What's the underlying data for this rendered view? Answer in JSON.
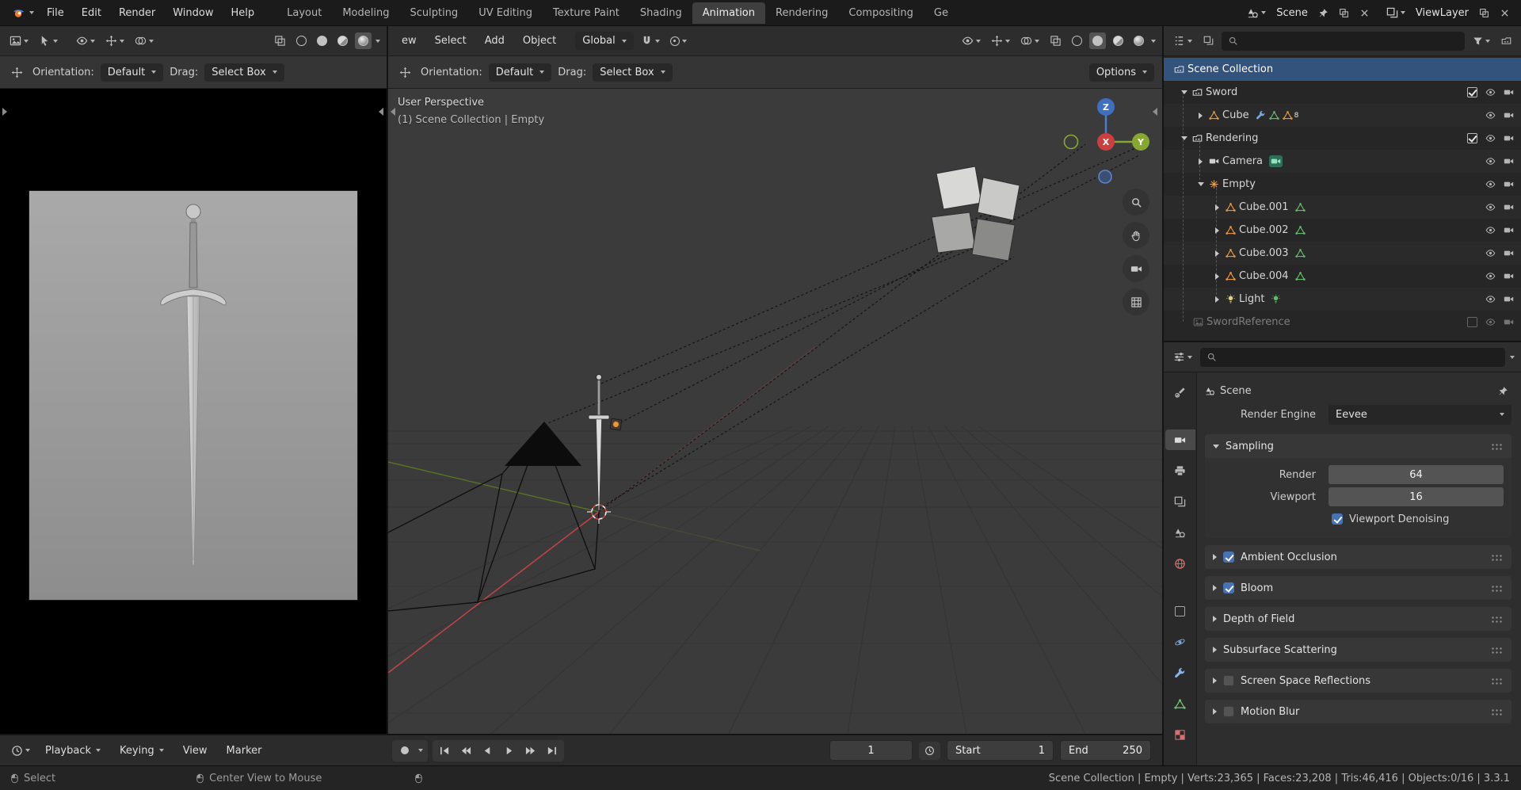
{
  "icons": {
    "logo": "blender-logo",
    "dropdown": "chevron-down",
    "search": "magnifier",
    "filter": "funnel",
    "pin": "pin",
    "duplicate": "copy",
    "close": "x",
    "eye": "eye",
    "camera_toggle": "movie-camera",
    "grip": "drag-dots"
  },
  "colors": {
    "accent": "#4772b3",
    "object_orange": "#e8973f",
    "data_green": "#66bb6a",
    "axis_x": "#cc3f3f",
    "axis_y": "#86a833",
    "axis_z": "#3f6fbf"
  },
  "topbar": {
    "menus": [
      "File",
      "Edit",
      "Render",
      "Window",
      "Help"
    ],
    "workspaces": [
      "Layout",
      "Modeling",
      "Sculpting",
      "UV Editing",
      "Texture Paint",
      "Shading",
      "Animation",
      "Rendering",
      "Compositing",
      "Ge"
    ],
    "active_workspace": "Animation",
    "scene_label": "Scene",
    "view_layer_label": "ViewLayer"
  },
  "left_editor": {
    "orientation_label": "Orientation:",
    "orientation_value": "Default",
    "drag_label": "Drag:",
    "drag_value": "Select Box"
  },
  "viewport": {
    "menus": [
      "ew",
      "Select",
      "Add",
      "Object"
    ],
    "transform_orientation": "Global",
    "orientation_label": "Orientation:",
    "orientation_value": "Default",
    "drag_label": "Drag:",
    "drag_value": "Select Box",
    "options_label": "Options",
    "overlay_title": "User Perspective",
    "overlay_subtitle": "(1) Scene Collection | Empty",
    "gizmo": {
      "x": "X",
      "y": "Y",
      "z": "Z"
    }
  },
  "outliner": {
    "rows": [
      {
        "label": "Scene Collection",
        "disclosure": "none",
        "checkbox": "none"
      },
      {
        "label": "Sword",
        "disclosure": "down",
        "checkbox": "on"
      },
      {
        "label": "Cube",
        "disclosure": "right",
        "checkbox": "none",
        "badge": "8"
      },
      {
        "label": "Rendering",
        "disclosure": "down",
        "checkbox": "on"
      },
      {
        "label": "Camera",
        "disclosure": "right",
        "checkbox": "none"
      },
      {
        "label": "Empty",
        "disclosure": "down",
        "checkbox": "none"
      },
      {
        "label": "Cube.001",
        "disclosure": "right",
        "checkbox": "none"
      },
      {
        "label": "Cube.002",
        "disclosure": "right",
        "checkbox": "none"
      },
      {
        "label": "Cube.003",
        "disclosure": "right",
        "checkbox": "none"
      },
      {
        "label": "Cube.004",
        "disclosure": "right",
        "checkbox": "none"
      },
      {
        "label": "Light",
        "disclosure": "right",
        "checkbox": "none"
      },
      {
        "label": "SwordReference",
        "disclosure": "none",
        "checkbox": "off"
      }
    ]
  },
  "properties": {
    "breadcrumb": "Scene",
    "render_engine_label": "Render Engine",
    "render_engine_value": "Eevee",
    "sampling": {
      "title": "Sampling",
      "render_label": "Render",
      "render_value": "64",
      "viewport_label": "Viewport",
      "viewport_value": "16",
      "denoise_label": "Viewport Denoising",
      "denoise_state": "on"
    },
    "sections": [
      {
        "label": "Ambient Occlusion",
        "checkbox": "on"
      },
      {
        "label": "Bloom",
        "checkbox": "on"
      },
      {
        "label": "Depth of Field",
        "checkbox": "none"
      },
      {
        "label": "Subsurface Scattering",
        "checkbox": "none"
      },
      {
        "label": "Screen Space Reflections",
        "checkbox": "off"
      },
      {
        "label": "Motion Blur",
        "checkbox": "off"
      }
    ]
  },
  "timeline": {
    "menus": [
      "Playback",
      "Keying",
      "View",
      "Marker"
    ],
    "current_frame": "1",
    "start_label": "Start",
    "start_value": "1",
    "end_label": "End",
    "end_value": "250"
  },
  "statusbar": {
    "left": "Select",
    "middle": "Center View to Mouse",
    "right": "Scene Collection | Empty | Verts:23,365 | Faces:23,208 | Tris:46,416 | Objects:0/16 | 3.3.1"
  }
}
